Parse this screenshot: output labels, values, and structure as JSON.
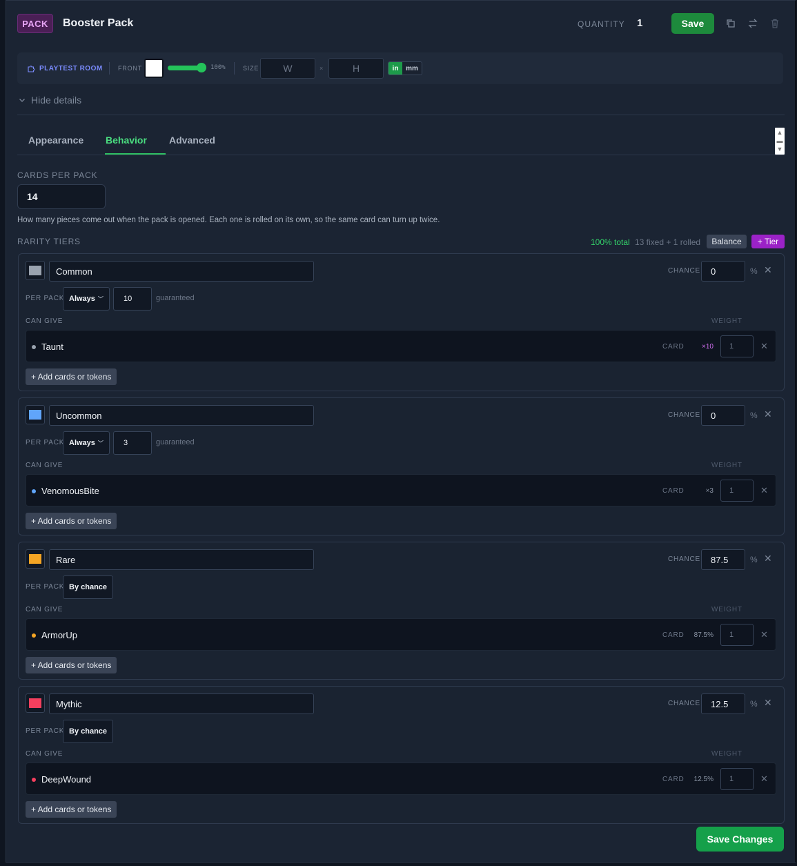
{
  "header": {
    "badge": "PACK",
    "title": "Booster Pack",
    "quantity_label": "QUANTITY",
    "quantity_value": "1",
    "save_label": "Save"
  },
  "toolbar": {
    "playtest_label": "PLAYTEST ROOM",
    "front_label": "FRONT",
    "opacity_text": "100%",
    "opacity_value": 1.0,
    "size_label": "SIZE",
    "width_placeholder": "W",
    "height_placeholder": "H",
    "x_sep": "×",
    "unit_in": "in",
    "unit_mm": "mm"
  },
  "details_toggle": "Hide details",
  "tabs": [
    {
      "label": "Appearance",
      "active": false
    },
    {
      "label": "Behavior",
      "active": true
    },
    {
      "label": "Advanced",
      "active": false
    }
  ],
  "cards_per_pack": {
    "label": "CARDS PER PACK",
    "value": "14",
    "help": "How many pieces come out when the pack is opened. Each one is rolled on its own, so the same card can turn up twice."
  },
  "rarity": {
    "label": "RARITY TIERS",
    "total": "100% total",
    "summary": "13 fixed + 1 rolled",
    "balance_label": "Balance",
    "add_tier_label": "+ Tier"
  },
  "tier_common": {
    "color": "#9aa3af",
    "name": "Common",
    "chance_label": "CHANCE",
    "chance": "0",
    "pct": "%",
    "per_pack_label": "PER PACK",
    "mode": "Always",
    "count": "10",
    "guaranteed": "guaranteed",
    "can_give_label": "CAN GIVE",
    "weight_label": "WEIGHT",
    "card_name": "Taunt",
    "card_type": "CARD",
    "card_mult": "×10",
    "card_weight": "1",
    "add_label": "+ Add cards or tokens"
  },
  "tier_uncommon": {
    "color": "#60a5fa",
    "name": "Uncommon",
    "chance_label": "CHANCE",
    "chance": "0",
    "pct": "%",
    "per_pack_label": "PER PACK",
    "mode": "Always",
    "count": "3",
    "guaranteed": "guaranteed",
    "can_give_label": "CAN GIVE",
    "weight_label": "WEIGHT",
    "card_name": "VenomousBite",
    "card_type": "CARD",
    "card_mult": "×3",
    "card_weight": "1",
    "add_label": "+ Add cards or tokens"
  },
  "tier_rare": {
    "color": "#f5a524",
    "name": "Rare",
    "chance_label": "CHANCE",
    "chance": "87.5",
    "pct": "%",
    "per_pack_label": "PER PACK",
    "mode": "By chance",
    "can_give_label": "CAN GIVE",
    "weight_label": "WEIGHT",
    "card_name": "ArmorUp",
    "card_type": "CARD",
    "card_mult": "87.5%",
    "card_weight": "1",
    "add_label": "+ Add cards or tokens"
  },
  "tier_mythic": {
    "color": "#f43f5e",
    "name": "Mythic",
    "chance_label": "CHANCE",
    "chance": "12.5",
    "pct": "%",
    "per_pack_label": "PER PACK",
    "mode": "By chance",
    "can_give_label": "CAN GIVE",
    "weight_label": "WEIGHT",
    "card_name": "DeepWound",
    "card_type": "CARD",
    "card_mult": "12.5%",
    "card_weight": "1",
    "add_label": "+ Add cards or tokens"
  },
  "footer": {
    "save_changes_label": "Save Changes"
  }
}
